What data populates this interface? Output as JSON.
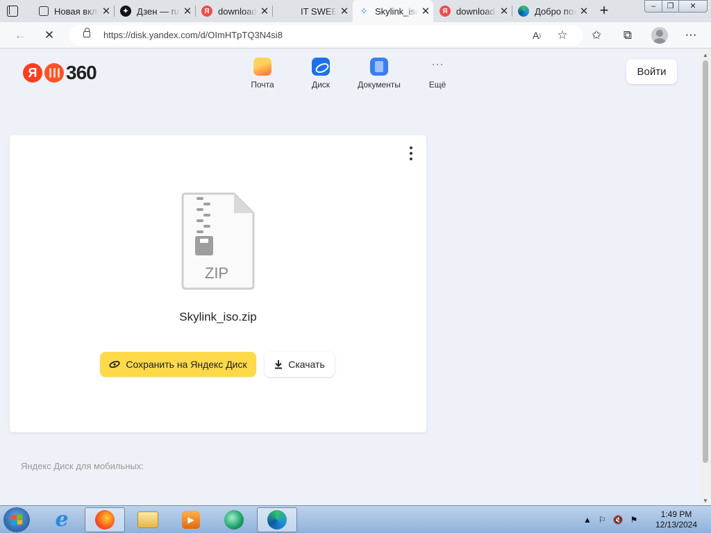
{
  "browser": {
    "tabs": [
      {
        "title": "Новая вкладка",
        "favicon": "calendar-grid-icon",
        "active": false
      },
      {
        "title": "Дзен — платформа",
        "favicon": "dzen-icon",
        "active": false
      },
      {
        "title": "download",
        "favicon": "yandex-icon",
        "active": false
      },
      {
        "title": "IT SWEET",
        "favicon": "",
        "active": false
      },
      {
        "title": "Skylink_iso",
        "favicon": "loading-spinner-icon",
        "active": true
      },
      {
        "title": "download",
        "favicon": "yandex-icon",
        "active": false
      },
      {
        "title": "Добро пожаловать",
        "favicon": "edge-icon",
        "active": false
      }
    ],
    "url": "https://disk.yandex.com/d/OImHTpTQ3N4si8"
  },
  "header": {
    "services": [
      {
        "label": "Почта",
        "icon": "mail-icon"
      },
      {
        "label": "Диск",
        "icon": "disk-icon"
      },
      {
        "label": "Документы",
        "icon": "documents-icon"
      },
      {
        "label": "Ещё",
        "icon": "more-icon"
      }
    ],
    "login_label": "Войти"
  },
  "file": {
    "type_label": "ZIP",
    "name": "Skylink_iso.zip",
    "save_label": "Сохранить на Яндекс Диск",
    "download_label": "Скачать"
  },
  "footer": {
    "mobile_text": "Яндекс Диск для мобильных:"
  },
  "taskbar": {
    "time": "1:49 PM",
    "date": "12/13/2024",
    "apps": [
      "internet-explorer-icon",
      "firefox-icon",
      "file-explorer-icon",
      "media-player-icon",
      "green-app-icon",
      "edge-icon"
    ]
  },
  "colors": {
    "page_bg": "#eef1f8",
    "save_button": "#fed94a",
    "yandex_red": "#fc3f1d"
  }
}
